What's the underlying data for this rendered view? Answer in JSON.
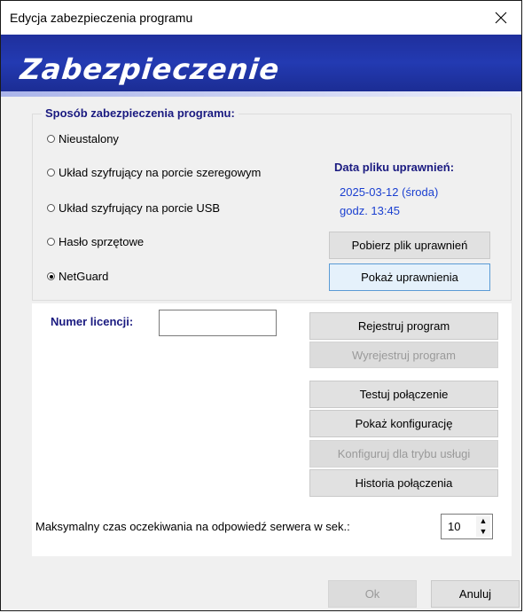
{
  "window": {
    "title": "Edycja zabezpieczenia programu",
    "banner": "Zabezpieczenie"
  },
  "protection": {
    "legend": "Sposób zabezpieczenia programu:",
    "options": [
      {
        "label": "Nieustalony",
        "selected": false
      },
      {
        "label": "Układ szyfrujący na porcie szeregowym",
        "selected": false
      },
      {
        "label": "Układ szyfrujący na porcie USB",
        "selected": false
      },
      {
        "label": "Hasło sprzętowe",
        "selected": false
      },
      {
        "label": "NetGuard",
        "selected": true
      }
    ]
  },
  "license_file": {
    "title": "Data pliku uprawnień:",
    "date": "2025-03-12 (środa)",
    "time": "godz. 13:45",
    "fetch_button": "Pobierz plik uprawnień",
    "show_button": "Pokaż uprawnienia"
  },
  "license": {
    "label": "Numer licencji:",
    "value": "",
    "placeholder": ""
  },
  "actions": {
    "register": "Rejestruj program",
    "unregister": "Wyrejestruj program",
    "test": "Testuj połączenie",
    "show_config": "Pokaż konfigurację",
    "configure_service": "Konfiguruj dla trybu usługi",
    "history": "Historia połączenia"
  },
  "timeout": {
    "label": "Maksymalny czas oczekiwania na odpowiedź serwera w sek.:",
    "value": "10"
  },
  "footer": {
    "ok": "Ok",
    "cancel": "Anuluj"
  },
  "colors": {
    "banner": "#233ab2",
    "label_blue": "#1a1a80",
    "date_blue": "#1a3fd0",
    "focus_border": "#5b9bd5"
  }
}
